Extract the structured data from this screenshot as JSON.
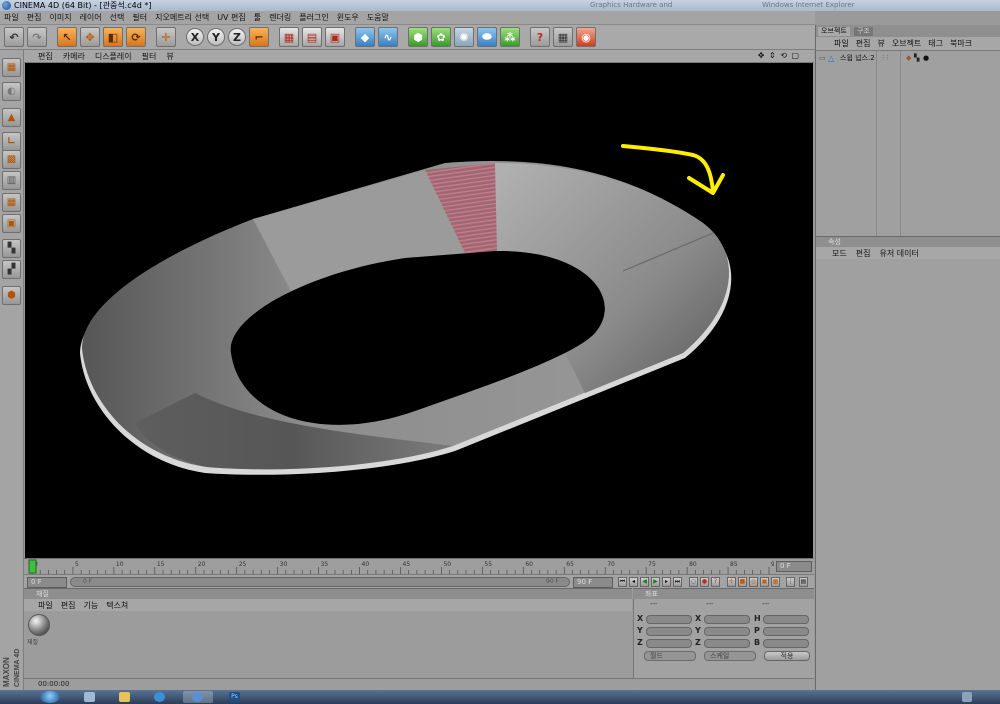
{
  "window": {
    "title": "CINEMA 4D (64 Bit) - [관중석.c4d *]",
    "background_title_1": "Graphics Hardware and",
    "background_title_2": "Windows Internet Explorer"
  },
  "menubar": [
    "파일",
    "편집",
    "이미지",
    "레이어",
    "선택",
    "필터",
    "지오메트리 선택",
    "UV 편집",
    "툴",
    "렌더링",
    "플러그인",
    "윈도우",
    "도움말"
  ],
  "toolbar": {
    "axis_x": "X",
    "axis_y": "Y",
    "axis_z": "Z"
  },
  "viewport": {
    "menu": [
      "편집",
      "카메라",
      "디스플레이",
      "필터",
      "뷰"
    ],
    "controls": "✥ ⇕ ⟲ ▢",
    "annotation_color": "#ffee00"
  },
  "timeline": {
    "ticks": [
      "0",
      "5",
      "10",
      "15",
      "20",
      "25",
      "30",
      "35",
      "40",
      "45",
      "50",
      "55",
      "60",
      "65",
      "70",
      "75",
      "80",
      "85",
      "90"
    ],
    "current_frame": "0 F",
    "start_frame": "0 F",
    "range_start": "0 F",
    "range_end": "90 F",
    "end_frame": "90 F"
  },
  "material": {
    "title": "재질",
    "menu": [
      "파일",
      "편집",
      "기능",
      "텍스쳐"
    ],
    "item_name": "재질"
  },
  "coordinates": {
    "title": "좌표",
    "headers": [
      "---",
      "---",
      "---"
    ],
    "col1": [
      "X",
      "Y",
      "Z"
    ],
    "col2": [
      "X",
      "Y",
      "Z"
    ],
    "col3": [
      "H",
      "P",
      "B"
    ],
    "dropdown1": "월드",
    "dropdown2": "스케일",
    "apply": "적용"
  },
  "objects": {
    "tab_active": "오브젝트",
    "tab_inactive": "구조",
    "menu": [
      "파일",
      "편집",
      "뷰",
      "오브젝트",
      "태그",
      "북마크"
    ],
    "item": "스윕 넙스.2"
  },
  "attributes": {
    "title": "속성",
    "menu": [
      "모드",
      "편집",
      "유저 데이터"
    ]
  },
  "status": {
    "time": "00:00:00"
  },
  "branding": {
    "line1": "MAXON",
    "line2": "CINEMA 4D"
  }
}
